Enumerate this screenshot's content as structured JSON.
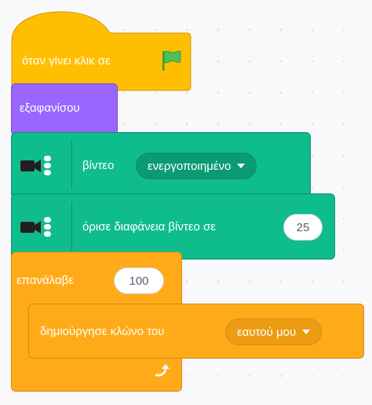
{
  "script": {
    "when_flag_clicked": {
      "label": "όταν γίνει κλικ σε",
      "icon": "green-flag-icon",
      "color": "#ffbf00"
    },
    "hide": {
      "label": "εξαφανίσου",
      "color": "#9966ff"
    },
    "video_toggle": {
      "label": "βίντεο",
      "dropdown_value": "ενεργοποιημένο",
      "icon": "video-camera-icon",
      "color": "#0fbd8c"
    },
    "set_video_transparency": {
      "label": "όρισε διαφάνεια βίντεο σε",
      "value": "25",
      "icon": "video-camera-icon",
      "color": "#0fbd8c"
    },
    "repeat": {
      "label": "επανάλαβε",
      "value": "100",
      "icon": "loop-arrow-icon",
      "color": "#ffab19"
    },
    "create_clone": {
      "label": "δημιούργησε κλώνο του",
      "dropdown_value": "εαυτού μου",
      "color": "#ffab19"
    }
  }
}
